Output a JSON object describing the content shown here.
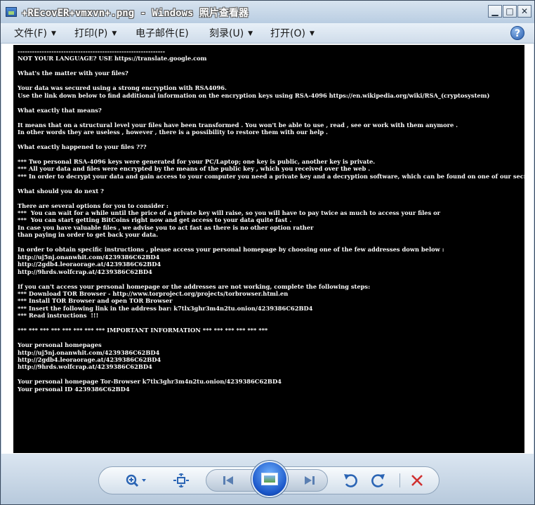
{
  "window": {
    "title": "+REcovER+vmxvn+.png - Windows 照片查看器",
    "buttons": {
      "minimize": "▁",
      "maximize": "□",
      "close": "✕"
    }
  },
  "menu": {
    "items": [
      {
        "label": "文件(F)"
      },
      {
        "label": "打印(P)"
      },
      {
        "label": "电子邮件(E)"
      },
      {
        "label": "刻录(U)"
      },
      {
        "label": "打开(O)"
      }
    ],
    "help": "?"
  },
  "image_text": "-------------------------------------------------------------\nNOT YOUR LANGUAGE? USE https://translate.google.com\n\nWhat's the matter with your files?\n\nYour data was secured using a strong encryption with RSA4096.\nUse the link down below to find additional information on the encryption keys using RSA-4096 https://en.wikipedia.org/wiki/RSA_(cryptosystem)\n\nWhat exactly that means?\n\nIt means that on a structural level your files have been transformed . You won't be able to use , read , see or work with them anymore .\nIn other words they are useless , however , there is a possibility to restore them with our help .\n\nWhat exactly happened to your files ???\n\n*** Two personal RSA-4096 keys were generated for your PC/Laptop; one key is public, another key is private.\n*** All your data and files were encrypted by the means of the public key , which you received over the web .\n*** In order to decrypt your data and gain access to your computer you need a private key and a decryption software, which can be found on one of our secret servers.\n\nWhat should you do next ?\n\nThere are several options for you to consider :\n***  You can wait for a while until the price of a private key will raise, so you will have to pay twice as much to access your files or\n***  You can start getting BitCoins right now and get access to your data quite fast .\nIn case you have valuable files , we advise you to act fast as there is no other option rather\nthan paying in order to get back your data.\n\nIn order to obtain specific instructions , please access your personal homepage by choosing one of the few addresses down below :\nhttp://uj5nj.onanwhit.com/4239386C62BD4\nhttp://2gdb4.leoraorage.at/4239386C62BD4\nhttp://9hrds.wolfcrap.at/4239386C62BD4\n\nIf you can't access your personal homepage or the addresses are not working, complete the following steps:\n*** Download TOR Browser - http://www.torproject.org/projects/torbrowser.html.en\n*** Install TOR Browser and open TOR Browser\n*** Insert the following link in the address bar: k7tlx3ghr3m4n2tu.onion/4239386C62BD4\n*** Read instructions  !!!\n\n*** *** *** *** *** *** *** *** IMPORTANT INFORMATION *** *** *** *** *** ***\n\nYour personal homepages\nhttp://uj5nj.onanwhit.com/4239386C62BD4\nhttp://2gdb4.leoraorage.at/4239386C62BD4\nhttp://9hrds.wolfcrap.at/4239386C62BD4\n\nYour personal homepage Tor-Browser k7tlx3ghr3m4n2tu.onion/4239386C62BD4\nYour personal ID 4239386C62BD4",
  "toolbar": {
    "icons": [
      "zoom-icon",
      "fit-to-window-icon",
      "previous-icon",
      "slideshow-icon",
      "next-icon",
      "rotate-counterclockwise-icon",
      "rotate-clockwise-icon",
      "delete-icon"
    ],
    "accent": "#2a64b4",
    "delete_color": "#d03030"
  }
}
